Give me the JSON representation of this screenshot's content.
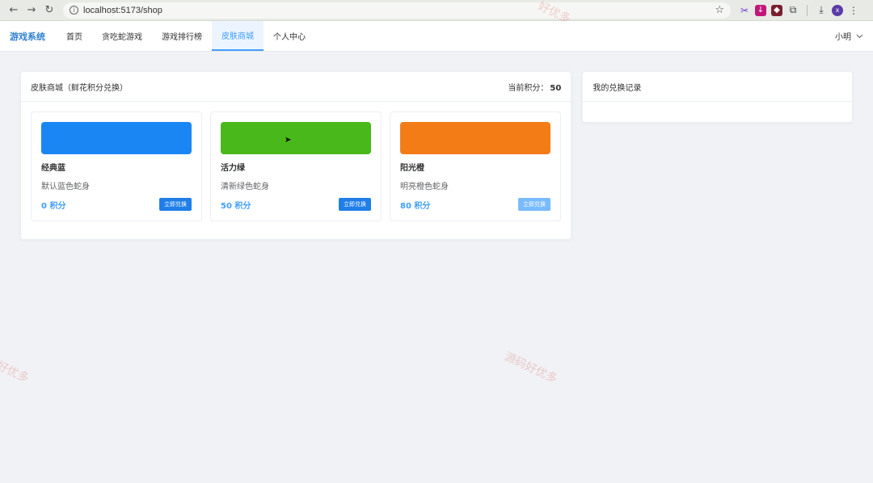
{
  "browser": {
    "url": "localhost:5173/shop",
    "profile_initial": "x"
  },
  "nav": {
    "brand": "游戏系统",
    "items": [
      {
        "label": "首页"
      },
      {
        "label": "贪吃蛇游戏"
      },
      {
        "label": "游戏排行榜"
      },
      {
        "label": "皮肤商城"
      },
      {
        "label": "个人中心"
      }
    ],
    "user": "小明"
  },
  "shop": {
    "title": "皮肤商城（鲜花积分兑换）",
    "points_label": "当前积分：",
    "points_value": "50",
    "skins": [
      {
        "name": "经典蓝",
        "desc": "默认蓝色蛇身",
        "price": "0 积分",
        "button": "立即兑换",
        "color": "#1a86f4"
      },
      {
        "name": "活力绿",
        "desc": "清新绿色蛇身",
        "price": "50 积分",
        "button": "立即兑换",
        "color": "#49b81b"
      },
      {
        "name": "阳光橙",
        "desc": "明亮橙色蛇身",
        "price": "80 积分",
        "button": "立即兑换",
        "color": "#f47c17"
      }
    ]
  },
  "records": {
    "title": "我的兑换记录"
  },
  "watermarks": [
    "源码好优多",
    "好优多",
    "源码好优多"
  ]
}
